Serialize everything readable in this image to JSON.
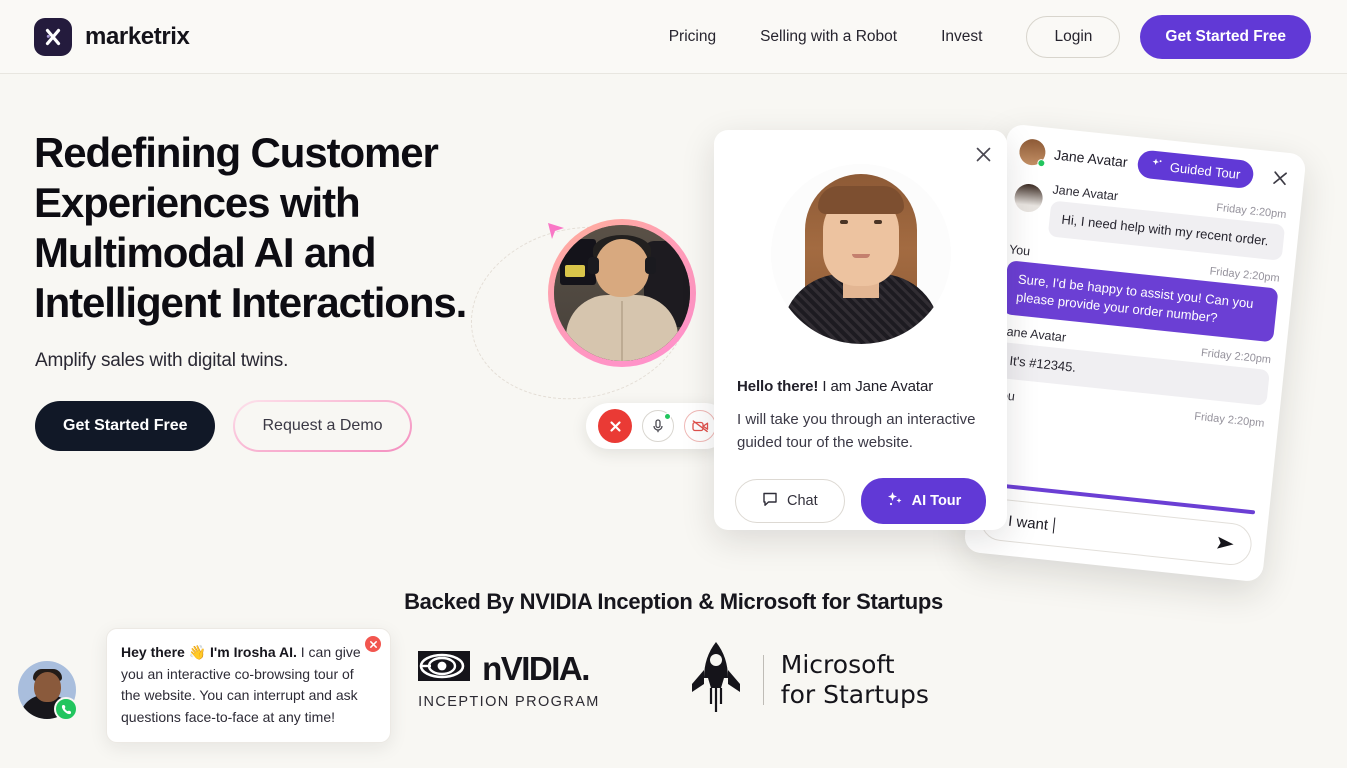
{
  "brand": {
    "name": "marketrix",
    "logo_icon": "x-logo-icon"
  },
  "nav": {
    "links": [
      {
        "label": "Pricing"
      },
      {
        "label": "Selling with a Robot"
      },
      {
        "label": "Invest"
      }
    ],
    "login_label": "Login",
    "cta_label": "Get Started Free"
  },
  "hero": {
    "heading": "Redefining Customer Experiences with Multimodal AI and Intelligent Interactions.",
    "subheading": "Amplify sales with digital twins.",
    "primary_cta": "Get Started Free",
    "secondary_cta": "Request a Demo"
  },
  "video_call": {
    "end_call_icon": "end-call-icon",
    "mic_icon": "microphone-icon",
    "video_off_icon": "video-off-icon",
    "status": "online"
  },
  "avatar_card": {
    "close_icon": "close-icon",
    "greeting_bold": "Hello there!",
    "greeting_rest": " I am Jane Avatar",
    "body": "I will take you through an interactive guided tour of the website.",
    "chat_label": "Chat",
    "chat_icon": "chat-bubble-icon",
    "ai_tour_label": "AI Tour",
    "ai_tour_icon": "sparkles-icon"
  },
  "chat_widget": {
    "header_name": "Jane Avatar",
    "guided_tour_label": "Guided Tour",
    "guided_tour_icon": "sparkles-icon",
    "close_icon": "close-icon",
    "messages": [
      {
        "sender": "Jane Avatar",
        "time": "Friday 2:20pm",
        "text": "Hi, I need help with my recent order.",
        "side": "them"
      },
      {
        "sender": "You",
        "time": "Friday 2:20pm",
        "text": "Sure, I'd be happy to assist you! Can you please provide your order number?",
        "side": "you"
      },
      {
        "sender": "Jane Avatar",
        "time": "Friday 2:20pm",
        "text": "It's #12345.",
        "side": "them"
      },
      {
        "sender": "You",
        "time": "Friday 2:20pm",
        "text": "",
        "side": "you"
      }
    ],
    "input_value": "d I want",
    "send_icon": "send-icon"
  },
  "backed": {
    "title": "Backed By NVIDIA Inception & Microsoft for Startups",
    "nvidia_word": "nVIDIA.",
    "nvidia_sub": "INCEPTION PROGRAM",
    "nvidia_icon": "nvidia-eye-icon",
    "microsoft_line1": "Microsoft",
    "microsoft_line2": "for Startups",
    "microsoft_icon": "rocket-icon"
  },
  "irosha": {
    "greeting_bold_1": "Hey there",
    "emoji": "👋",
    "greeting_bold_2": "I'm Irosha AI.",
    "body": "I can give you an interactive co-browsing tour of the website. You can interrupt and ask questions face-to-face at any time!",
    "close_icon": "close-icon",
    "phone_icon": "phone-icon"
  },
  "colors": {
    "background": "#f8f7f3",
    "accent_purple": "#6139d6",
    "dark": "#111827",
    "danger_red": "#ea3a35",
    "online_green": "#22c55e"
  }
}
